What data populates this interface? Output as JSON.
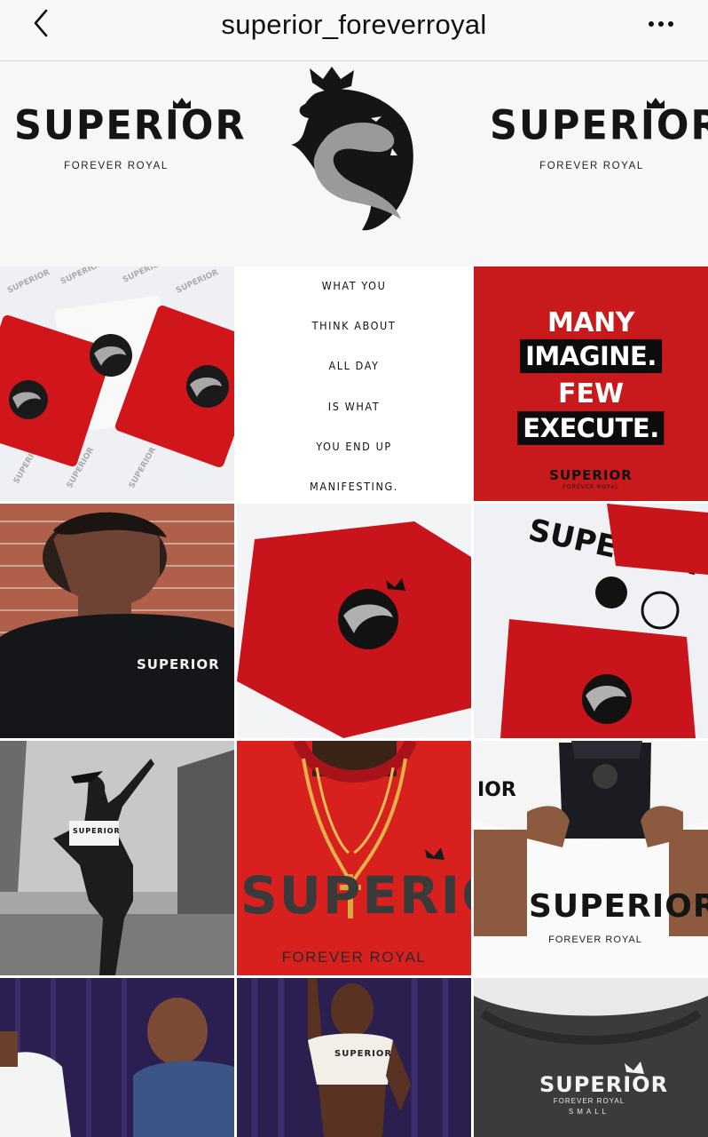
{
  "header": {
    "username": "superior_foreverroyal",
    "back_icon": "chevron-left-icon",
    "more_icon": "more-horizontal-icon"
  },
  "banner": {
    "brand_name": "SUPERIOR",
    "tagline": "FOREVER ROYAL",
    "logo": "lion-crown-logo"
  },
  "grid": {
    "quote_lines": [
      "WHAT YOU",
      "THINK ABOUT",
      "ALL DAY",
      "IS WHAT",
      "YOU END UP",
      "MANIFESTING."
    ],
    "poster": {
      "line1": "MANY",
      "line2": "IMAGINE.",
      "line3": "FEW",
      "line4": "EXECUTE.",
      "brand": "SUPERIOR",
      "tagline": "FOREVER ROYAL"
    },
    "tee_text": {
      "back_print": "SUPERIOR",
      "big_print": "SUPERIOR",
      "big_tagline": "FOREVER ROYAL",
      "crop_top": "SUPERIOR",
      "white_tee": "SUPERIOR",
      "white_tee_tagline": "FOREVER ROYAL",
      "label_brand": "SUPERIOR",
      "label_tagline": "FOREVER ROYAL",
      "label_size": "SMALL"
    },
    "colors": {
      "brand_red": "#c81a1c",
      "brand_black": "#141414"
    }
  }
}
